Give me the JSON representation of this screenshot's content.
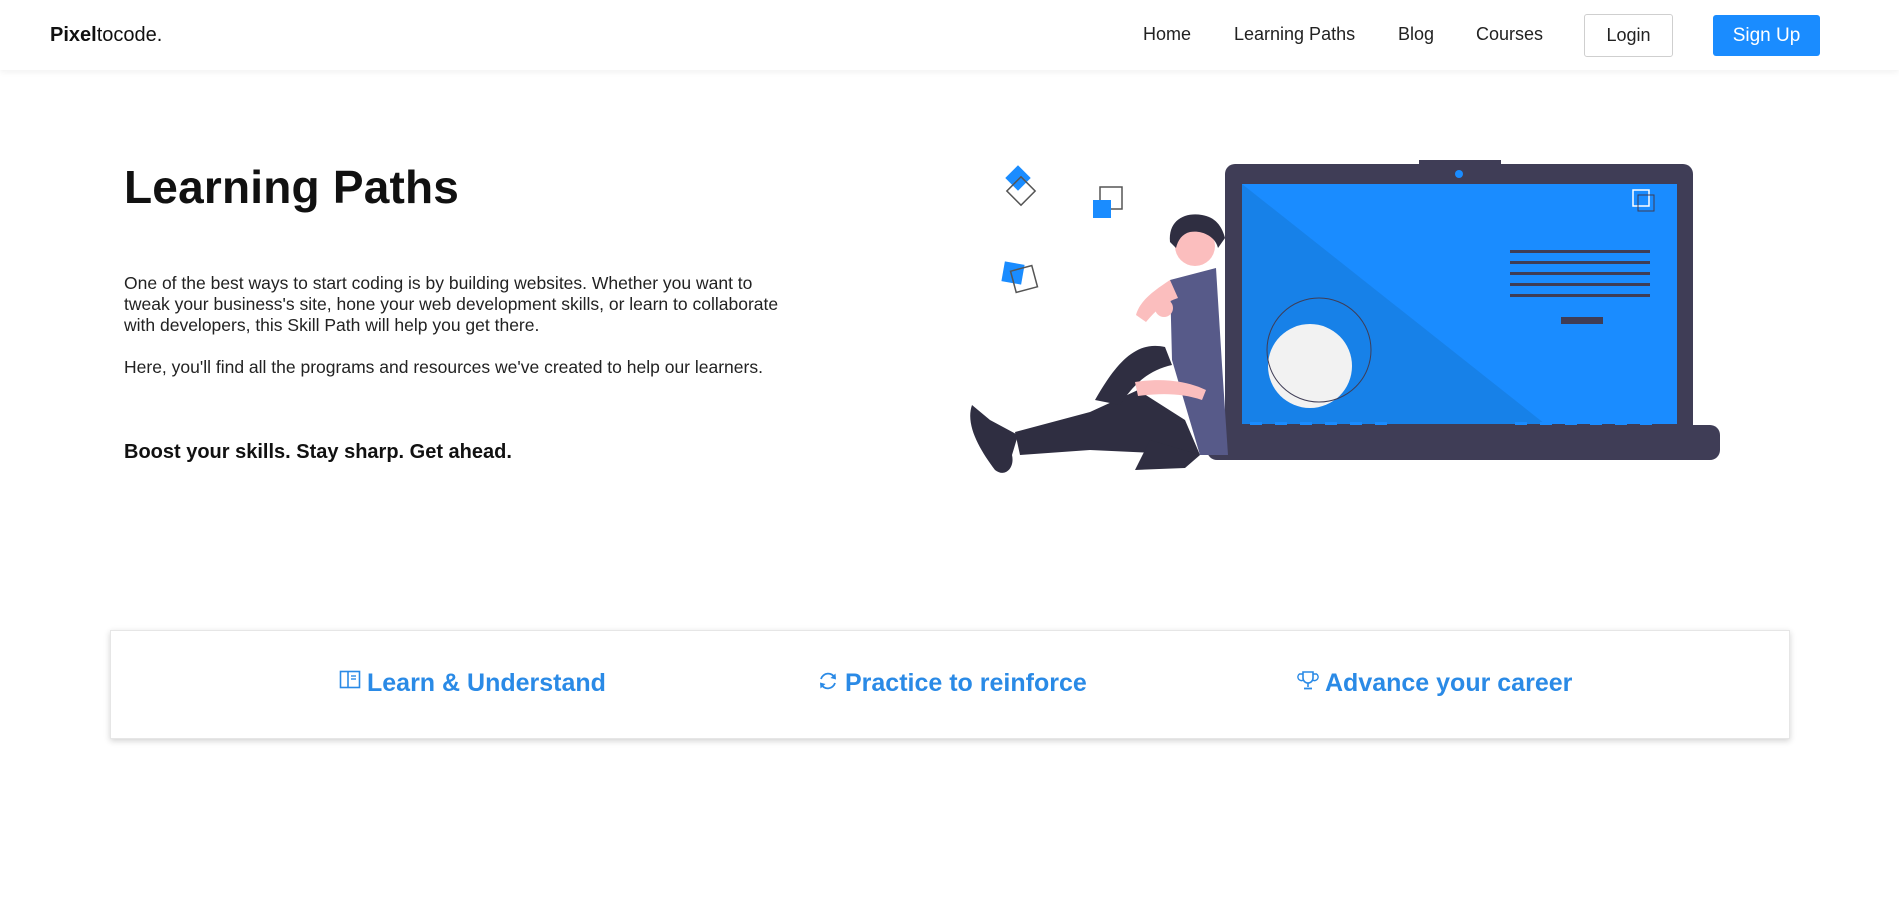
{
  "brand": {
    "bold": "Pixel",
    "light": "tocode."
  },
  "nav": {
    "home": "Home",
    "learning_paths": "Learning Paths",
    "blog": "Blog",
    "courses": "Courses",
    "login": "Login",
    "signup": "Sign Up"
  },
  "hero": {
    "title": "Learning Paths",
    "paragraph1": "One of the best ways to start coding is by building websites. Whether you want to tweak your business's site, hone your web development skills, or learn to collaborate with developers, this Skill Path will help you get there.",
    "paragraph2": "Here, you'll find all the programs and resources we've created to help our learners.",
    "tagline": "Boost your skills. Stay sharp. Get ahead."
  },
  "features": [
    {
      "label": "Learn & Understand",
      "icon": "book-icon"
    },
    {
      "label": "Practice to reinforce",
      "icon": "refresh-icon"
    },
    {
      "label": "Advance your career",
      "icon": "trophy-icon"
    }
  ],
  "colors": {
    "accent": "#1a8cff",
    "feature_text": "#2a8ae6",
    "laptop_body": "#3f3d56",
    "laptop_screen": "#1a8cff"
  }
}
